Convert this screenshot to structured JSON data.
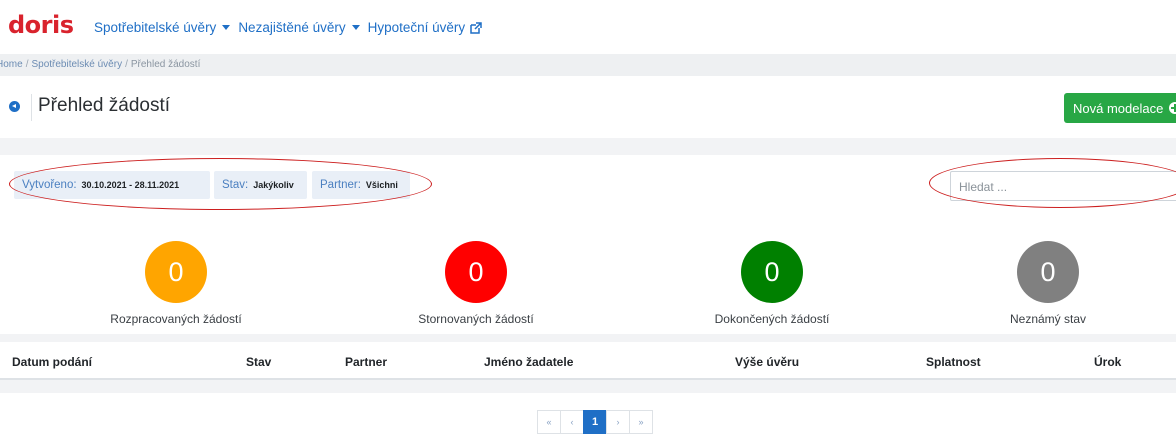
{
  "app": {
    "logo_text": "doris",
    "brand_color": "#d9232d"
  },
  "nav": {
    "items": [
      {
        "label": "Spotřebitelské úvěry",
        "has_dropdown": true
      },
      {
        "label": "Nezajištěné úvěry",
        "has_dropdown": true
      },
      {
        "label": "Hypoteční úvěry",
        "external": true
      }
    ]
  },
  "breadcrumb": {
    "items": [
      "Home",
      "Spotřebitelské úvěry",
      "Přehled žádostí"
    ]
  },
  "page": {
    "title": "Přehled žádostí",
    "new_button": "Nová modelace"
  },
  "filters": {
    "created": {
      "label": "Vytvořeno:",
      "value": "30.10.2021 - 28.11.2021"
    },
    "status": {
      "label": "Stav:",
      "value": "Jakýkoliv"
    },
    "partner": {
      "label": "Partner:",
      "value": "Všichni"
    },
    "search_placeholder": "Hledat ..."
  },
  "stats": [
    {
      "count": "0",
      "label": "Rozpracovaných žádostí",
      "color": "#ffa500"
    },
    {
      "count": "0",
      "label": "Stornovaných žádostí",
      "color": "#ff0000"
    },
    {
      "count": "0",
      "label": "Dokončených žádostí",
      "color": "#008000"
    },
    {
      "count": "0",
      "label": "Neznámý stav",
      "color": "#808080"
    }
  ],
  "table": {
    "columns": [
      "Datum podání",
      "Stav",
      "Partner",
      "Jméno žadatele",
      "Výše úvěru",
      "Splatnost",
      "Úrok"
    ]
  },
  "pagination": {
    "first": "«",
    "prev": "‹",
    "current": "1",
    "next": "›",
    "last": "»"
  },
  "annotation_color": "#cc1f1f"
}
